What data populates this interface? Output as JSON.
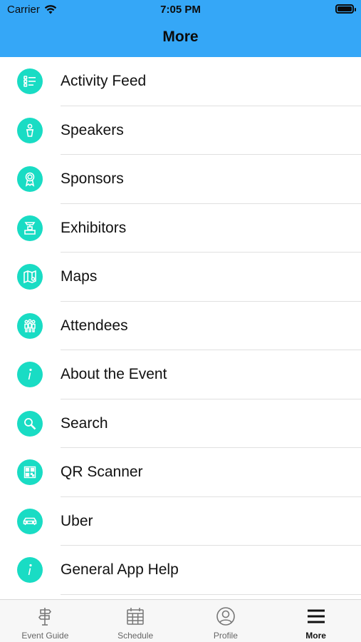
{
  "status_bar": {
    "carrier": "Carrier",
    "time": "7:05 PM"
  },
  "nav": {
    "title": "More"
  },
  "accent_color": "#19dcc4",
  "header_color": "#35a7f7",
  "menu": [
    {
      "label": "Activity Feed",
      "icon": "list-icon"
    },
    {
      "label": "Speakers",
      "icon": "speaker-podium-icon"
    },
    {
      "label": "Sponsors",
      "icon": "ribbon-award-icon"
    },
    {
      "label": "Exhibitors",
      "icon": "booth-icon"
    },
    {
      "label": "Maps",
      "icon": "map-icon"
    },
    {
      "label": "Attendees",
      "icon": "people-icon"
    },
    {
      "label": "About the Event",
      "icon": "info-icon"
    },
    {
      "label": "Search",
      "icon": "search-icon"
    },
    {
      "label": "QR Scanner",
      "icon": "qr-code-icon"
    },
    {
      "label": "Uber",
      "icon": "car-icon"
    },
    {
      "label": "General App Help",
      "icon": "help-info-icon"
    }
  ],
  "tabs": [
    {
      "label": "Event Guide",
      "icon": "signpost-icon"
    },
    {
      "label": "Schedule",
      "icon": "calendar-icon"
    },
    {
      "label": "Profile",
      "icon": "profile-icon"
    },
    {
      "label": "More",
      "icon": "hamburger-menu-icon",
      "active": true
    }
  ]
}
